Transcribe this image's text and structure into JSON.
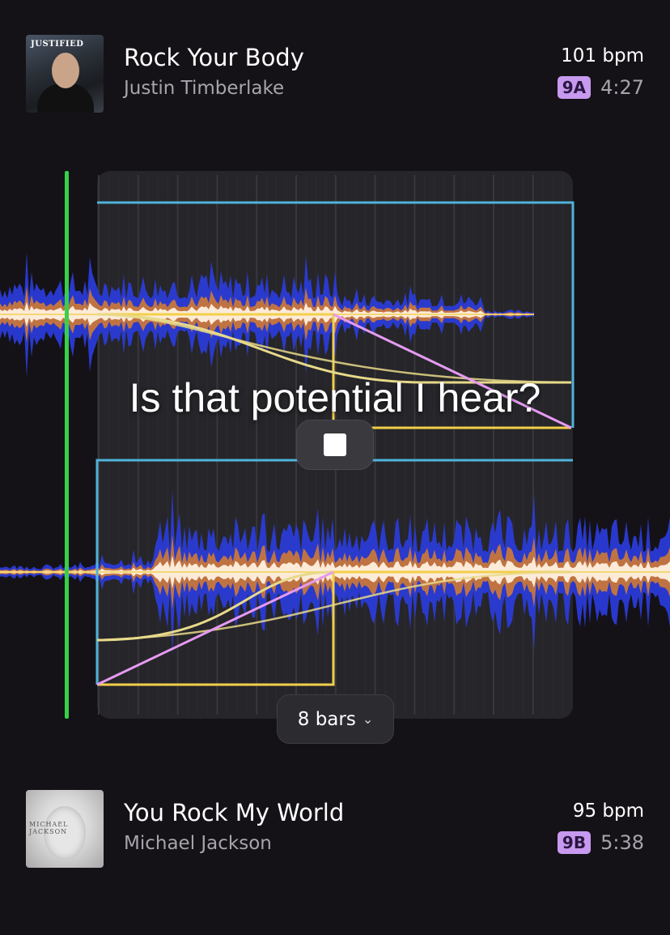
{
  "deck_a": {
    "title": "Rock Your Body",
    "artist": "Justin Timberlake",
    "bpm": "101 bpm",
    "key": "9A",
    "duration": "4:27",
    "album_art_text": "JUSTIFIED",
    "album_art_icon": "album-cover-justified"
  },
  "deck_b": {
    "title": "You Rock My World",
    "artist": "Michael Jackson",
    "bpm": "95 bpm",
    "key": "9B",
    "duration": "5:38",
    "album_art_text": "MICHAEL JACKSON",
    "album_art_icon": "album-cover-invincible"
  },
  "caption": "Is that potential I hear?",
  "controls": {
    "stop_icon": "stop-square-icon",
    "bars_label": "8 bars",
    "bars_icon": "chevron-down-icon"
  },
  "colors": {
    "background": "#141216",
    "panel": "#262529",
    "waveform_low": "#2a3bd6",
    "waveform_mid": "#c8763a",
    "waveform_high": "#fff1e0",
    "playhead": "#37d04a",
    "key_badge": "#c79af0",
    "region_border": "#4fb3d9",
    "curve_volume": "#f2cf4a",
    "curve_eq": "#e7d98a",
    "curve_filter": "#e59af2"
  }
}
